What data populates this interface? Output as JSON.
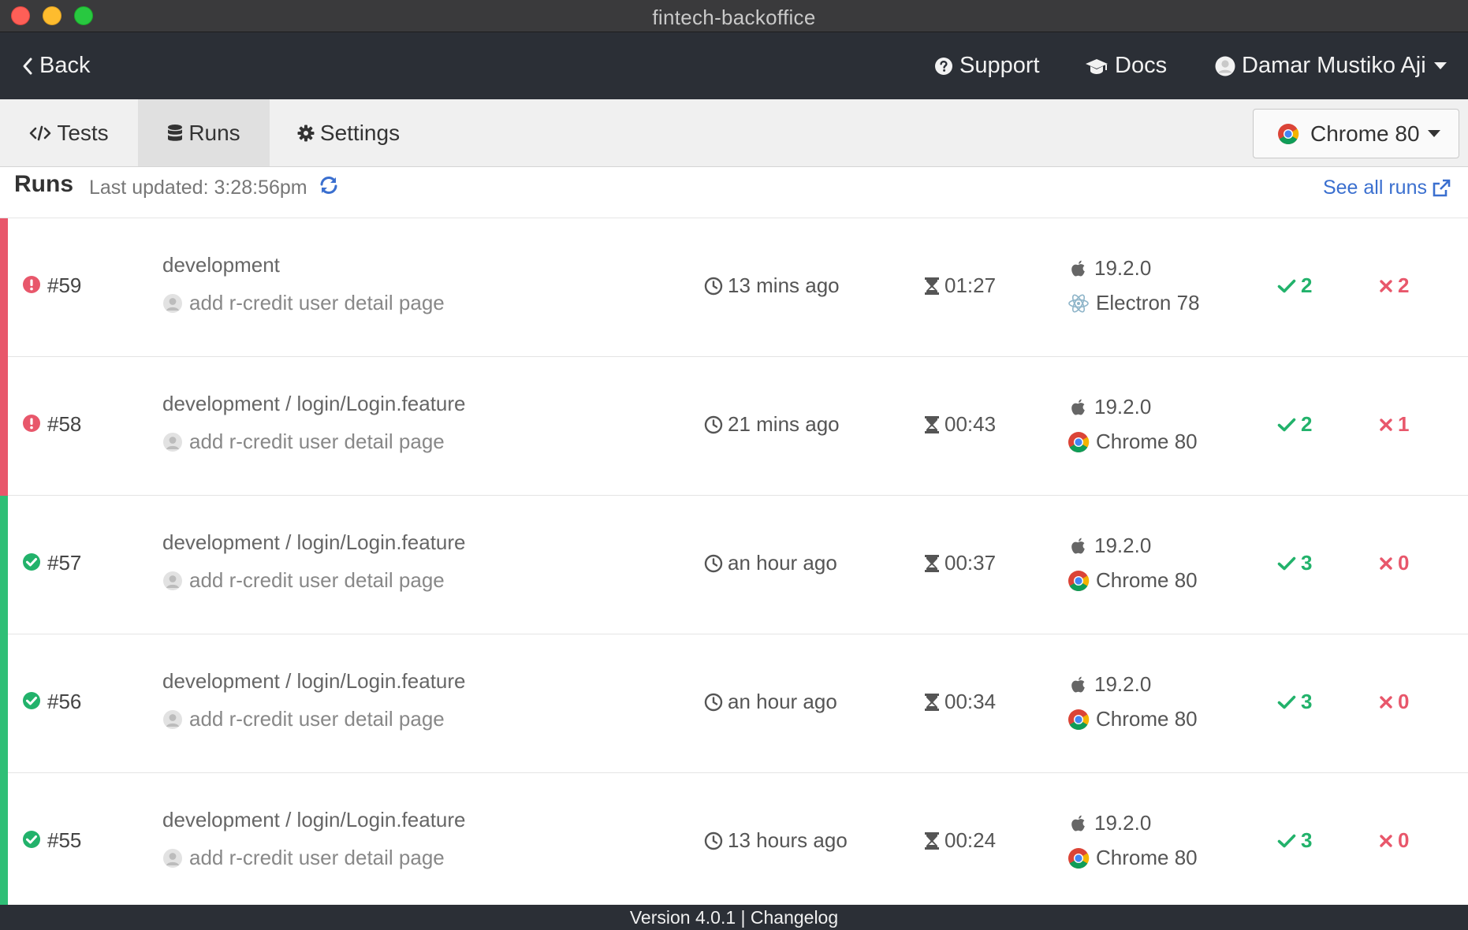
{
  "window": {
    "title": "fintech-backoffice"
  },
  "topnav": {
    "back_label": "Back",
    "support_label": "Support",
    "docs_label": "Docs",
    "user_name": "Damar Mustiko Aji"
  },
  "tabs": [
    {
      "label": "Tests",
      "icon": "code-icon",
      "active": false
    },
    {
      "label": "Runs",
      "icon": "database-icon",
      "active": true
    },
    {
      "label": "Settings",
      "icon": "gear-icon",
      "active": false
    }
  ],
  "browser_select": {
    "label": "Chrome 80",
    "icon": "chrome-icon"
  },
  "runs_header": {
    "title": "Runs",
    "last_updated": "Last updated: 3:28:56pm",
    "see_all": "See all runs"
  },
  "colors": {
    "failed": "#e8576b",
    "passed": "#2fbf76",
    "link": "#3a6fcf",
    "nav_bg": "#2b2f36"
  },
  "runs": [
    {
      "status": "failed",
      "number": "#59",
      "branch": "development",
      "commit": "add r-credit user detail page",
      "ago": "13 mins ago",
      "duration": "01:27",
      "os": "19.2.0",
      "browser": "Electron 78",
      "browser_icon": "electron-icon",
      "passed": "2",
      "failed": "2"
    },
    {
      "status": "failed",
      "number": "#58",
      "branch": "development / login/Login.feature",
      "commit": "add r-credit user detail page",
      "ago": "21 mins ago",
      "duration": "00:43",
      "os": "19.2.0",
      "browser": "Chrome 80",
      "browser_icon": "chrome-icon",
      "passed": "2",
      "failed": "1"
    },
    {
      "status": "passed",
      "number": "#57",
      "branch": "development / login/Login.feature",
      "commit": "add r-credit user detail page",
      "ago": "an hour ago",
      "duration": "00:37",
      "os": "19.2.0",
      "browser": "Chrome 80",
      "browser_icon": "chrome-icon",
      "passed": "3",
      "failed": "0"
    },
    {
      "status": "passed",
      "number": "#56",
      "branch": "development / login/Login.feature",
      "commit": "add r-credit user detail page",
      "ago": "an hour ago",
      "duration": "00:34",
      "os": "19.2.0",
      "browser": "Chrome 80",
      "browser_icon": "chrome-icon",
      "passed": "3",
      "failed": "0"
    },
    {
      "status": "passed",
      "number": "#55",
      "branch": "development / login/Login.feature",
      "commit": "add r-credit user detail page",
      "ago": "13 hours ago",
      "duration": "00:24",
      "os": "19.2.0",
      "browser": "Chrome 80",
      "browser_icon": "chrome-icon",
      "passed": "3",
      "failed": "0"
    }
  ],
  "footer": {
    "text": "Version 4.0.1 | Changelog"
  }
}
